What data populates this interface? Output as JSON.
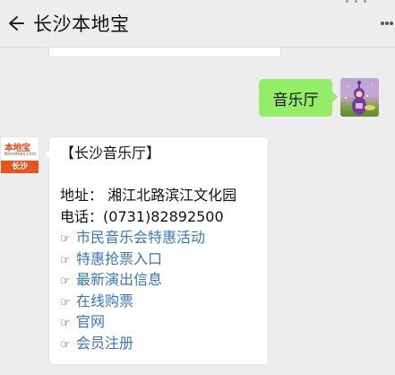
{
  "header": {
    "title": "长沙本地宝",
    "back_icon": "back-arrow-icon",
    "more_icon": "more-dots-icon"
  },
  "chat": {
    "sent_message": "音乐厅",
    "bot": {
      "avatar_brand": "本地宝",
      "avatar_url": "Bendibao.com",
      "avatar_city": "长沙"
    },
    "reply": {
      "heading": "【长沙音乐厅】",
      "address_label": "地址：",
      "address_value": "湘江北路滨江文化园",
      "phone_label": "电话：",
      "phone_value": "(0731)82892500",
      "bullet_glyph": "☞",
      "links": [
        "市民音乐会特惠活动",
        "特惠抢票入口",
        "最新演出信息",
        "在线购票",
        "官网",
        "会员注册"
      ]
    }
  },
  "colors": {
    "background": "#ededed",
    "sent_bubble": "#95ec69",
    "link": "#3f76b3",
    "brand_orange": "#e8541e"
  }
}
